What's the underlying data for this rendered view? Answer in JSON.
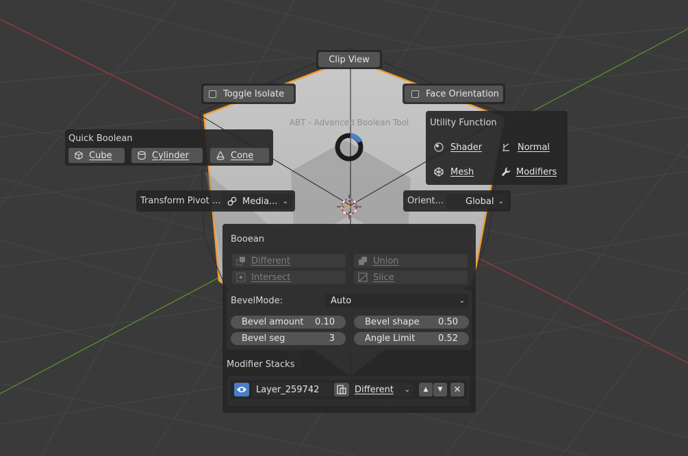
{
  "pie": {
    "title": "ABT - Advanced Boolean Tool",
    "clip_view": "Clip View",
    "toggle_isolate": "Toggle Isolate",
    "face_orientation": "Face Orientation",
    "quick_boolean": {
      "title": "Quick Boolean",
      "items": [
        "Cube",
        "Cylinder",
        "Cone"
      ]
    },
    "utility": {
      "title": "Utility Function",
      "items": [
        "Shader",
        "Normal",
        "Mesh",
        "Modifiers"
      ]
    },
    "transform_pivot": {
      "label": "Transform Pivot ...",
      "value": "Media..."
    },
    "orientation": {
      "label": "Orient...",
      "value": "Global"
    }
  },
  "boolean_panel": {
    "title": "Booean",
    "ops": [
      "Different",
      "Union",
      "Intersect",
      "Slice"
    ],
    "bevel_mode_label": "BevelMode:",
    "bevel_mode_value": "Auto",
    "fields": [
      {
        "label": "Bevel amount",
        "value": "0.10"
      },
      {
        "label": "Bevel shape",
        "value": "0.50"
      },
      {
        "label": "Bevel seg",
        "value": "3"
      },
      {
        "label": "Angle Limit",
        "value": "0.52"
      }
    ],
    "modifier_stacks_title": "Modifier Stacks",
    "modifier": {
      "name": "Layer_259742",
      "operation": "Different"
    }
  },
  "colors": {
    "viewport_bg": "#3a3a3a",
    "selection_outline": "#f29a2e",
    "x_axis": "#c0392b",
    "y_axis": "#6aa32b",
    "accent_blue": "#4a7ec7"
  }
}
